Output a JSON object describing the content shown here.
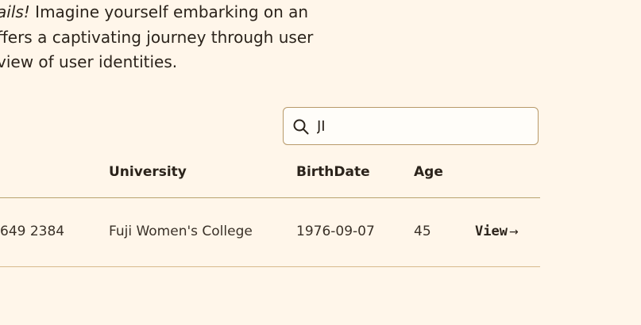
{
  "intro": {
    "line1_em": "ails!",
    "line1_rest": " Imagine yourself embarking on an",
    "line2": "ffers a captivating journey through user",
    "line3": "view of user identities."
  },
  "search": {
    "value": "JI",
    "icon": "search-icon"
  },
  "table": {
    "columns": [
      "University",
      "BirthDate",
      "Age"
    ],
    "rows": [
      {
        "phone": "649 2384",
        "university": "Fuji Women's College",
        "birthdate": "1976-09-07",
        "age": "45",
        "action_label": "View",
        "action_arrow": "→"
      }
    ]
  }
}
